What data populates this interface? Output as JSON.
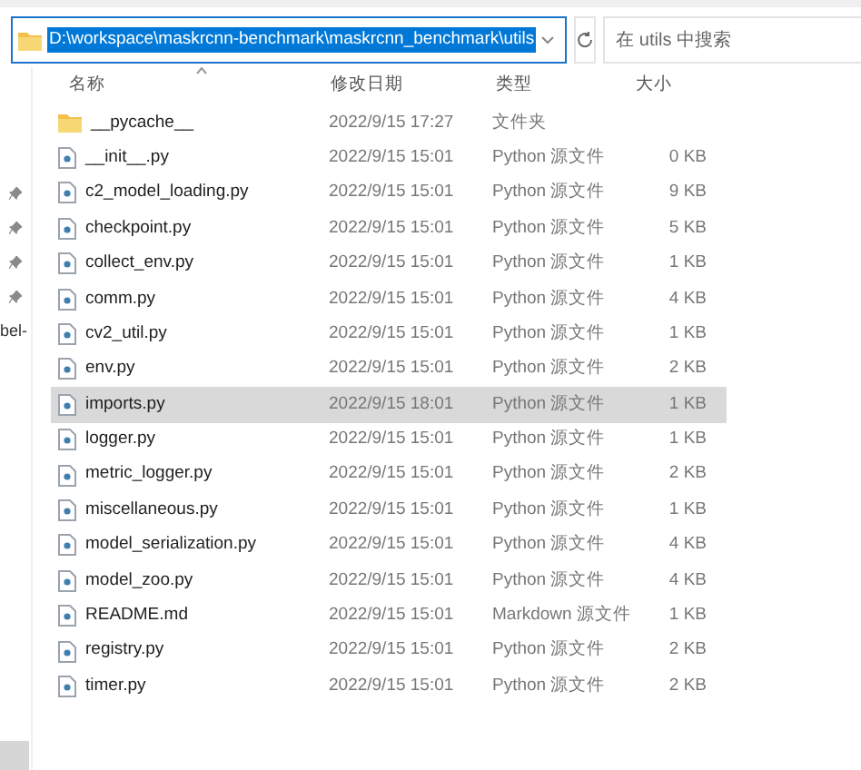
{
  "address_bar": {
    "path": "D:\\workspace\\maskrcnn-benchmark\\maskrcnn_benchmark\\utils",
    "selected": true
  },
  "search": {
    "placeholder": "在 utils 中搜索"
  },
  "nav_pane": {
    "label": "bel-"
  },
  "columns": [
    {
      "label": "名称",
      "sorted": true
    },
    {
      "label": "修改日期",
      "sorted": false
    },
    {
      "label": "类型",
      "sorted": false
    },
    {
      "label": "大小",
      "sorted": false
    }
  ],
  "files": [
    {
      "kind": "folder",
      "name": "__pycache__",
      "date": "2022/9/15 17:27",
      "type": "文件夹",
      "selected": false
    },
    {
      "kind": "file",
      "name": "__init__.py",
      "date": "2022/9/15 15:01",
      "type": "Python 源文件",
      "size": "0 KB",
      "selected": false
    },
    {
      "kind": "file",
      "name": "c2_model_loading.py",
      "date": "2022/9/15 15:01",
      "type": "Python 源文件",
      "size": "9 KB",
      "selected": false
    },
    {
      "kind": "file",
      "name": "checkpoint.py",
      "date": "2022/9/15 15:01",
      "type": "Python 源文件",
      "size": "5 KB",
      "selected": false
    },
    {
      "kind": "file",
      "name": "collect_env.py",
      "date": "2022/9/15 15:01",
      "type": "Python 源文件",
      "size": "1 KB",
      "selected": false
    },
    {
      "kind": "file",
      "name": "comm.py",
      "date": "2022/9/15 15:01",
      "type": "Python 源文件",
      "size": "4 KB",
      "selected": false
    },
    {
      "kind": "file",
      "name": "cv2_util.py",
      "date": "2022/9/15 15:01",
      "type": "Python 源文件",
      "size": "1 KB",
      "selected": false
    },
    {
      "kind": "file",
      "name": "env.py",
      "date": "2022/9/15 15:01",
      "type": "Python 源文件",
      "size": "2 KB",
      "selected": false
    },
    {
      "kind": "file",
      "name": "imports.py",
      "date": "2022/9/15 18:01",
      "type": "Python 源文件",
      "size": "1 KB",
      "selected": true
    },
    {
      "kind": "file",
      "name": "logger.py",
      "date": "2022/9/15 15:01",
      "type": "Python 源文件",
      "size": "1 KB",
      "selected": false
    },
    {
      "kind": "file",
      "name": "metric_logger.py",
      "date": "2022/9/15 15:01",
      "type": "Python 源文件",
      "size": "2 KB",
      "selected": false
    },
    {
      "kind": "file",
      "name": "miscellaneous.py",
      "date": "2022/9/15 15:01",
      "type": "Python 源文件",
      "size": "1 KB",
      "selected": false
    },
    {
      "kind": "file",
      "name": "model_serialization.py",
      "date": "2022/9/15 15:01",
      "type": "Python 源文件",
      "size": "4 KB",
      "selected": false
    },
    {
      "kind": "file",
      "name": "model_zoo.py",
      "date": "2022/9/15 15:01",
      "type": "Python 源文件",
      "size": "4 KB",
      "selected": false
    },
    {
      "kind": "file",
      "name": "README.md",
      "date": "2022/9/15 15:01",
      "type": "Markdown 源文件",
      "size": "1 KB",
      "selected": false
    },
    {
      "kind": "file",
      "name": "registry.py",
      "date": "2022/9/15 15:01",
      "type": "Python 源文件",
      "size": "2 KB",
      "selected": false
    },
    {
      "kind": "file",
      "name": "timer.py",
      "date": "2022/9/15 15:01",
      "type": "Python 源文件",
      "size": "2 KB",
      "selected": false
    }
  ]
}
